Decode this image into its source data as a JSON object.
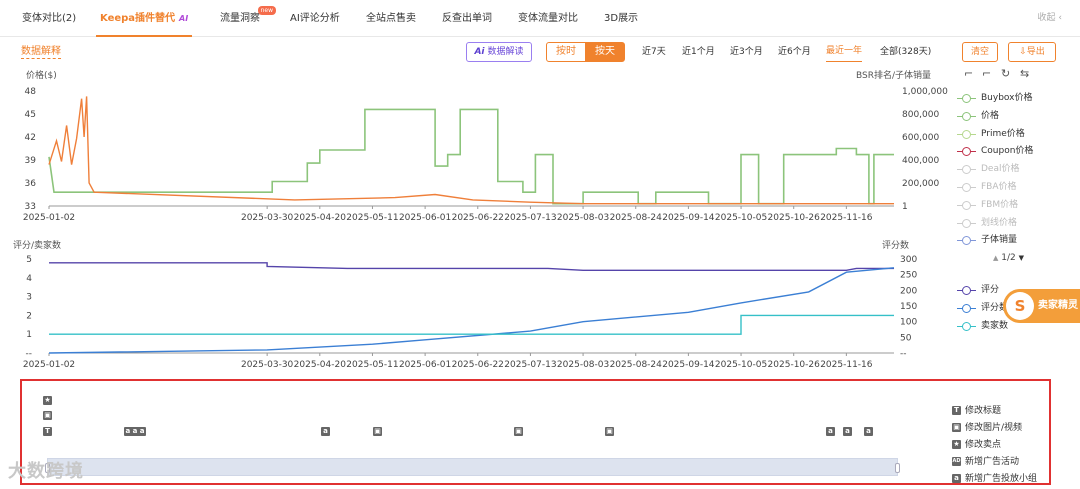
{
  "tabs": [
    {
      "label": "变体对比(2)"
    },
    {
      "label": "Keepa插件替代",
      "badge": "AI"
    },
    {
      "label": "流量洞察",
      "badge": "new"
    },
    {
      "label": "AI评论分析"
    },
    {
      "label": "全站点售卖"
    },
    {
      "label": "反查出单词"
    },
    {
      "label": "变体流量对比"
    },
    {
      "label": "3D展示"
    }
  ],
  "collapse_label": "收起",
  "collapse_icon": "chevron-up-icon",
  "toolbar": {
    "data_explain": "数据解释",
    "ai_label": "Ai",
    "ai_text": "数据解读",
    "by_hour": "按时",
    "by_day": "按天",
    "ranges": [
      "近7天",
      "近1个月",
      "近3个月",
      "近6个月",
      "最近一年",
      "全部(328天)"
    ],
    "active_range": "最近一年",
    "clear": "清空",
    "export": "导出"
  },
  "colors": {
    "accent": "#f0822d",
    "price_green": "#8cc47b",
    "buybox_orange": "#ef7f3a",
    "rating_purple": "#5544aa",
    "reviews_blue": "#3b7fd4",
    "sellers_teal": "#35c0c8",
    "coupon_red": "#c0304a",
    "subsales_blue": "#8096d8"
  },
  "chart_data": [
    {
      "type": "line",
      "title": "",
      "xlabel": "",
      "ylabel": "价格($)",
      "y2label": "BSR排名/子体销量",
      "x_ticks": [
        "2025-01-02",
        "2025-03-30",
        "2025-04-20",
        "2025-05-11",
        "2025-06-01",
        "2025-06-22",
        "2025-07-13",
        "2025-08-03",
        "2025-08-24",
        "2025-09-14",
        "2025-10-05",
        "2025-10-26",
        "2025-11-16"
      ],
      "ylim": [
        33,
        48
      ],
      "y_ticks": [
        48,
        45,
        42,
        39,
        36,
        33
      ],
      "y2_ticks": [
        "1,000,000",
        "800,000",
        "600,000",
        "400,000",
        "200,000",
        "1"
      ],
      "y2lim": [
        0,
        1000000
      ],
      "series": [
        {
          "name": "价格",
          "axis": "left",
          "points": [
            [
              "2025-01-02",
              39.4
            ],
            [
              "2025-01-04",
              34.8
            ],
            [
              "2025-04-01",
              34.8
            ],
            [
              "2025-04-01",
              36.2
            ],
            [
              "2025-04-15",
              36.2
            ],
            [
              "2025-04-15",
              38.6
            ],
            [
              "2025-04-20",
              38.6
            ],
            [
              "2025-04-20",
              40.3
            ],
            [
              "2025-05-08",
              40.3
            ],
            [
              "2025-05-08",
              45.6
            ],
            [
              "2025-06-05",
              45.6
            ],
            [
              "2025-06-05",
              38.2
            ],
            [
              "2025-06-10",
              38.2
            ],
            [
              "2025-06-10",
              39.7
            ],
            [
              "2025-06-15",
              39.7
            ],
            [
              "2025-06-15",
              45.6
            ],
            [
              "2025-06-30",
              45.6
            ],
            [
              "2025-06-30",
              36.2
            ],
            [
              "2025-07-10",
              36.2
            ],
            [
              "2025-07-10",
              34.8
            ],
            [
              "2025-07-15",
              34.8
            ],
            [
              "2025-07-15",
              39.7
            ],
            [
              "2025-07-22",
              39.7
            ],
            [
              "2025-07-22",
              33.3
            ],
            [
              "2025-08-03",
              33.3
            ],
            [
              "2025-08-03",
              34.8
            ],
            [
              "2025-08-25",
              34.8
            ],
            [
              "2025-08-25",
              33.3
            ],
            [
              "2025-09-01",
              33.3
            ],
            [
              "2025-09-01",
              34.8
            ],
            [
              "2025-09-22",
              34.8
            ],
            [
              "2025-09-22",
              33.3
            ],
            [
              "2025-10-05",
              33.3
            ],
            [
              "2025-10-05",
              39.7
            ],
            [
              "2025-10-12",
              39.7
            ],
            [
              "2025-10-12",
              33.3
            ],
            [
              "2025-10-22",
              33.3
            ],
            [
              "2025-10-22",
              39.7
            ],
            [
              "2025-11-12",
              39.7
            ],
            [
              "2025-11-12",
              40.5
            ],
            [
              "2025-11-20",
              40.5
            ],
            [
              "2025-11-20",
              39.7
            ],
            [
              "2025-11-25",
              39.7
            ],
            [
              "2025-11-25",
              33.3
            ],
            [
              "2025-11-27",
              33.3
            ],
            [
              "2025-11-27",
              39.7
            ],
            [
              "2025-12-05",
              39.7
            ]
          ]
        },
        {
          "name": "Buybox价格",
          "axis": "left",
          "points": [
            [
              "2025-01-02",
              38.4
            ],
            [
              "2025-01-05",
              41.5
            ],
            [
              "2025-01-07",
              38.8
            ],
            [
              "2025-01-09",
              43.5
            ],
            [
              "2025-01-11",
              38.4
            ],
            [
              "2025-01-13",
              41.8
            ],
            [
              "2025-01-15",
              47.0
            ],
            [
              "2025-01-16",
              42.0
            ],
            [
              "2025-01-17",
              47.3
            ],
            [
              "2025-01-18",
              36.0
            ],
            [
              "2025-01-20",
              34.8
            ],
            [
              "2025-04-10",
              33.8
            ],
            [
              "2025-05-20",
              34.1
            ],
            [
              "2025-06-05",
              34.5
            ],
            [
              "2025-06-20",
              33.8
            ],
            [
              "2025-07-13",
              33.5
            ],
            [
              "2025-08-03",
              33.3
            ],
            [
              "2025-10-05",
              33.3
            ],
            [
              "2025-12-05",
              33.3
            ]
          ]
        }
      ]
    },
    {
      "type": "line",
      "title": "",
      "xlabel": "",
      "ylabel": "评分/卖家数",
      "y2label": "评分数",
      "x_ticks": [
        "2025-01-02",
        "2025-03-30",
        "2025-04-20",
        "2025-05-11",
        "2025-06-01",
        "2025-06-22",
        "2025-07-13",
        "2025-08-03",
        "2025-08-24",
        "2025-09-14",
        "2025-10-05",
        "2025-10-26",
        "2025-11-16"
      ],
      "ylim": [
        0,
        5
      ],
      "y_ticks": [
        5,
        4,
        3,
        2,
        1,
        "--"
      ],
      "y2lim": [
        0,
        300
      ],
      "y2_ticks": [
        300,
        250,
        200,
        150,
        100,
        50,
        "--"
      ],
      "series": [
        {
          "name": "评分",
          "axis": "left",
          "points": [
            [
              "2025-01-02",
              4.8
            ],
            [
              "2025-03-30",
              4.8
            ],
            [
              "2025-03-30",
              4.6
            ],
            [
              "2025-05-01",
              4.5
            ],
            [
              "2025-07-20",
              4.5
            ],
            [
              "2025-08-03",
              4.4
            ],
            [
              "2025-11-16",
              4.4
            ],
            [
              "2025-11-20",
              4.5
            ],
            [
              "2025-12-05",
              4.5
            ]
          ]
        },
        {
          "name": "评分数",
          "axis": "right",
          "points": [
            [
              "2025-01-02",
              0
            ],
            [
              "2025-03-30",
              10
            ],
            [
              "2025-05-11",
              28
            ],
            [
              "2025-06-01",
              42
            ],
            [
              "2025-07-13",
              70
            ],
            [
              "2025-08-03",
              100
            ],
            [
              "2025-09-14",
              130
            ],
            [
              "2025-10-05",
              160
            ],
            [
              "2025-11-01",
              195
            ],
            [
              "2025-11-16",
              258
            ],
            [
              "2025-12-05",
              272
            ]
          ]
        },
        {
          "name": "卖家数",
          "axis": "left",
          "points": [
            [
              "2025-01-02",
              1
            ],
            [
              "2025-10-05",
              1
            ],
            [
              "2025-10-05",
              2
            ],
            [
              "2025-12-05",
              2
            ]
          ]
        }
      ]
    }
  ],
  "legend_top": [
    {
      "label": "Buybox价格",
      "color": "#8cc47b",
      "dim": false
    },
    {
      "label": "价格",
      "color": "#8cc47b",
      "dim": false
    },
    {
      "label": "Prime价格",
      "color": "#b6d88e",
      "dim": false
    },
    {
      "label": "Coupon价格",
      "color": "#c0304a",
      "dim": false
    },
    {
      "label": "Deal价格",
      "color": "#cccccc",
      "dim": true
    },
    {
      "label": "FBA价格",
      "color": "#cccccc",
      "dim": true
    },
    {
      "label": "FBM价格",
      "color": "#cccccc",
      "dim": true
    },
    {
      "label": "划线价格",
      "color": "#cccccc",
      "dim": true
    },
    {
      "label": "子体销量",
      "color": "#8096d8",
      "dim": false
    }
  ],
  "legend_pager": "1/2",
  "legend_bottom": [
    {
      "label": "评分",
      "color": "#5544aa"
    },
    {
      "label": "评分数",
      "color": "#3b7fd4"
    },
    {
      "label": "卖家数",
      "color": "#35c0c8"
    }
  ],
  "seller_sprite": {
    "logo": "S",
    "label": "卖家精灵"
  },
  "events": {
    "legend": [
      {
        "icon": "T",
        "label": "修改标题"
      },
      {
        "icon": "▣",
        "label": "修改图片/视频"
      },
      {
        "icon": "★",
        "label": "修改卖点"
      },
      {
        "icon": "AD",
        "label": "新增广告活动"
      },
      {
        "icon": "a",
        "label": "新增广告投放小组"
      }
    ],
    "marks": [
      "★",
      "▣",
      "T",
      "a",
      "▣",
      "▣",
      "▣",
      "a",
      "a",
      "a"
    ],
    "cluster_mark": "a a a"
  },
  "watermark": "大数跨境"
}
